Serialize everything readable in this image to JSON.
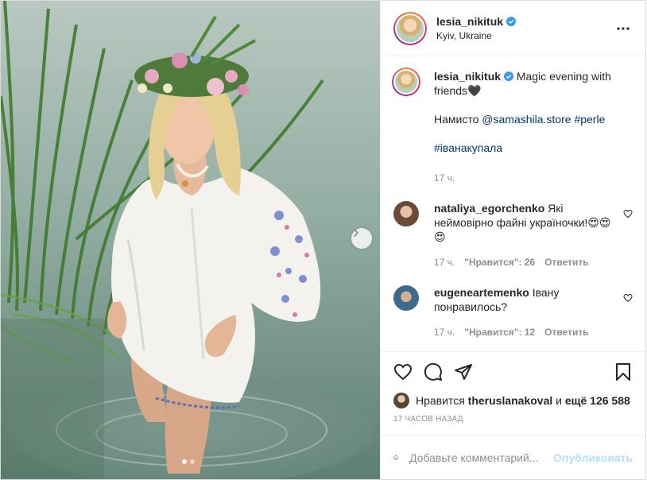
{
  "post": {
    "author": "lesia_nikituk",
    "location": "Kyiv, Ukraine",
    "caption": {
      "text_1": "Magic evening with friends🖤",
      "necklace_label": "Намисто",
      "mention": "@samashila.store",
      "tag_perle": "#perle",
      "tag_ivana": "#іванакупала",
      "time": "17 ч."
    }
  },
  "comments": [
    {
      "user": "nataliya_egorchenko",
      "text": "Які неймовірно файні україночки!😍😍😍",
      "time": "17 ч.",
      "likes": "\"Нравится\": 26",
      "reply": "Ответить"
    },
    {
      "user": "eugeneartemenko",
      "text": "Івану понравилось?",
      "time": "17 ч.",
      "likes": "\"Нравится\": 12",
      "reply": "Ответить"
    }
  ],
  "likes_line": {
    "prefix": "Нравится",
    "user": "theruslanakoval",
    "connector": "и",
    "others": "ещё 126 588"
  },
  "timestamp": "17 часов назад",
  "add_comment": {
    "placeholder": "Добавьте комментарий...",
    "publish": "Опубликовать"
  },
  "icons": {
    "more": "more-dots-icon",
    "like": "heart-icon",
    "comment": "comment-icon",
    "share": "share-icon",
    "save": "bookmark-icon",
    "emoji": "emoji-icon",
    "next": "chevron-right-icon"
  },
  "colors": {
    "link": "#00376b",
    "muted": "#8e8e8e",
    "verified": "#3897f0",
    "publish_disabled": "#b2dffc"
  },
  "carousel": {
    "current": 1,
    "total": 2
  }
}
